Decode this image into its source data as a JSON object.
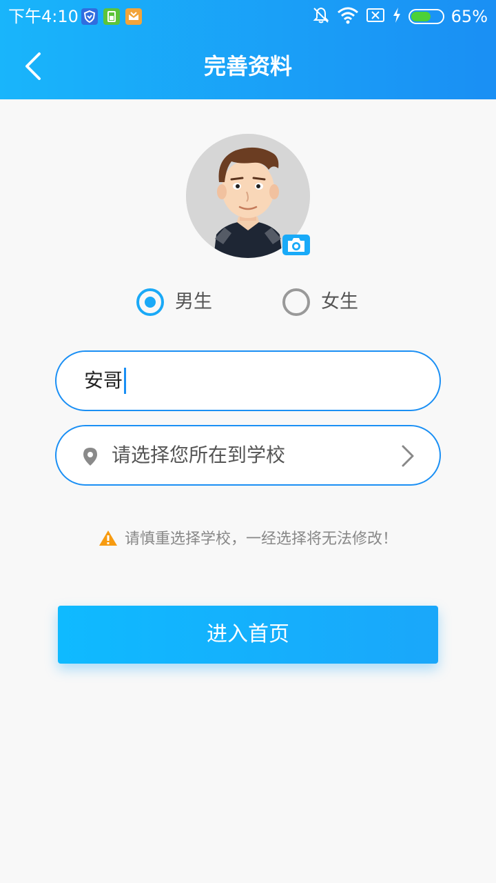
{
  "status_bar": {
    "time": "下午4:10",
    "battery_percent": "65%",
    "battery_level": 0.65,
    "icons": [
      "shield-icon",
      "sim-icon",
      "app-notification-icon",
      "mute-bell-icon",
      "wifi-icon",
      "no-sim-icon",
      "charging-bolt-icon",
      "battery-icon"
    ]
  },
  "nav": {
    "title": "完善资料",
    "back_icon": "chevron-left-icon"
  },
  "profile": {
    "avatar_icon": "cartoon-avatar",
    "camera_icon": "camera-icon"
  },
  "gender": {
    "male_label": "男生",
    "female_label": "女生",
    "selected": "male"
  },
  "form": {
    "name_value": "安哥",
    "school_placeholder": "请选择您所在到学校"
  },
  "warning": {
    "text": "请慎重选择学校，一经选择将无法修改！",
    "icon": "warning-triangle-icon"
  },
  "actions": {
    "enter_label": "进入首页"
  },
  "colors": {
    "primary": "#1a8ff4",
    "accent": "#19b5fb",
    "warning": "#f79b10"
  }
}
